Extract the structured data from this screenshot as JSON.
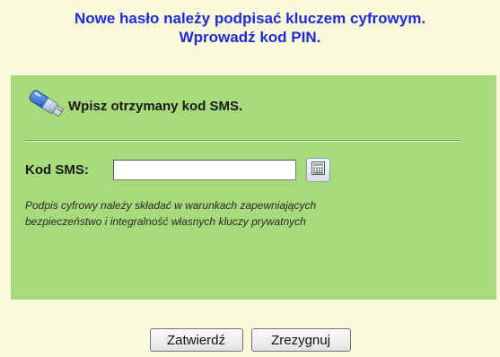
{
  "heading": {
    "line1": "Nowe hasło należy podpisać kluczem cyfrowym.",
    "line2": "Wprowadź kod PIN."
  },
  "panel": {
    "icon": "usb-key-icon",
    "title": "Wpisz otrzymany kod SMS.",
    "sms_label": "Kod SMS:",
    "sms_value": "",
    "keyboard_icon": "virtual-keyboard-icon",
    "note_line1": "Podpis cyfrowy należy składać  w warunkach zapewniających",
    "note_line2": "bezpieczeństwo i integralność własnych kluczy prywatnych"
  },
  "buttons": {
    "confirm": "Zatwierdź",
    "cancel": "Zrezygnuj"
  },
  "colors": {
    "page_background": "#fbf9dc",
    "heading_text": "#1f2ad6",
    "panel_background": "#a6da7a"
  }
}
